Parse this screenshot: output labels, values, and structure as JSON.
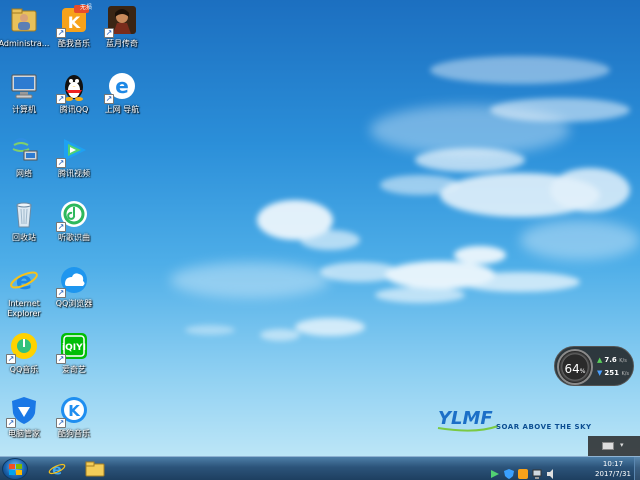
{
  "desktop_icons": [
    {
      "label": "Administra...",
      "icon": "user-folder-icon"
    },
    {
      "label": "酷我音乐",
      "icon": "kuwo-music-icon",
      "badge": "无损"
    },
    {
      "label": "蓝月传奇",
      "icon": "game-icon"
    },
    {
      "label": "计算机",
      "icon": "computer-icon"
    },
    {
      "label": "腾讯QQ",
      "icon": "qq-penguin-icon"
    },
    {
      "label": "上网 导航",
      "icon": "ie-browser-icon"
    },
    {
      "label": "网络",
      "icon": "network-icon"
    },
    {
      "label": "腾讯视频",
      "icon": "tencent-video-icon"
    },
    {
      "label": "回收站",
      "icon": "recycle-bin-icon"
    },
    {
      "label": "听歌识曲",
      "icon": "music-recognize-icon"
    },
    {
      "label": "Internet\nExplorer",
      "icon": "internet-explorer-icon"
    },
    {
      "label": "QQ浏览器",
      "icon": "qq-browser-icon"
    },
    {
      "label": "QQ音乐",
      "icon": "qq-music-icon"
    },
    {
      "label": "爱奇艺",
      "icon": "iqiyi-icon"
    },
    {
      "label": "电脑管家",
      "icon": "pc-manager-icon"
    },
    {
      "label": "酷狗音乐",
      "icon": "kugou-icon"
    }
  ],
  "logo": {
    "brand": "YLMF",
    "tagline": "SOAR ABOVE THE SKY"
  },
  "gadget": {
    "cpu_percent": "64",
    "percent_sign": "%",
    "upload": "7.6",
    "download": "251",
    "unit": "K/s"
  },
  "taskbar": {
    "pinned": [
      "start-orb",
      "internet-explorer",
      "file-explorer"
    ],
    "clock_time": "10:17",
    "clock_date": "2017/7/31"
  },
  "colors": {
    "sky_top": "#1c6fc0",
    "taskbar": "#2b5379",
    "accent_green": "#5bd05b"
  }
}
